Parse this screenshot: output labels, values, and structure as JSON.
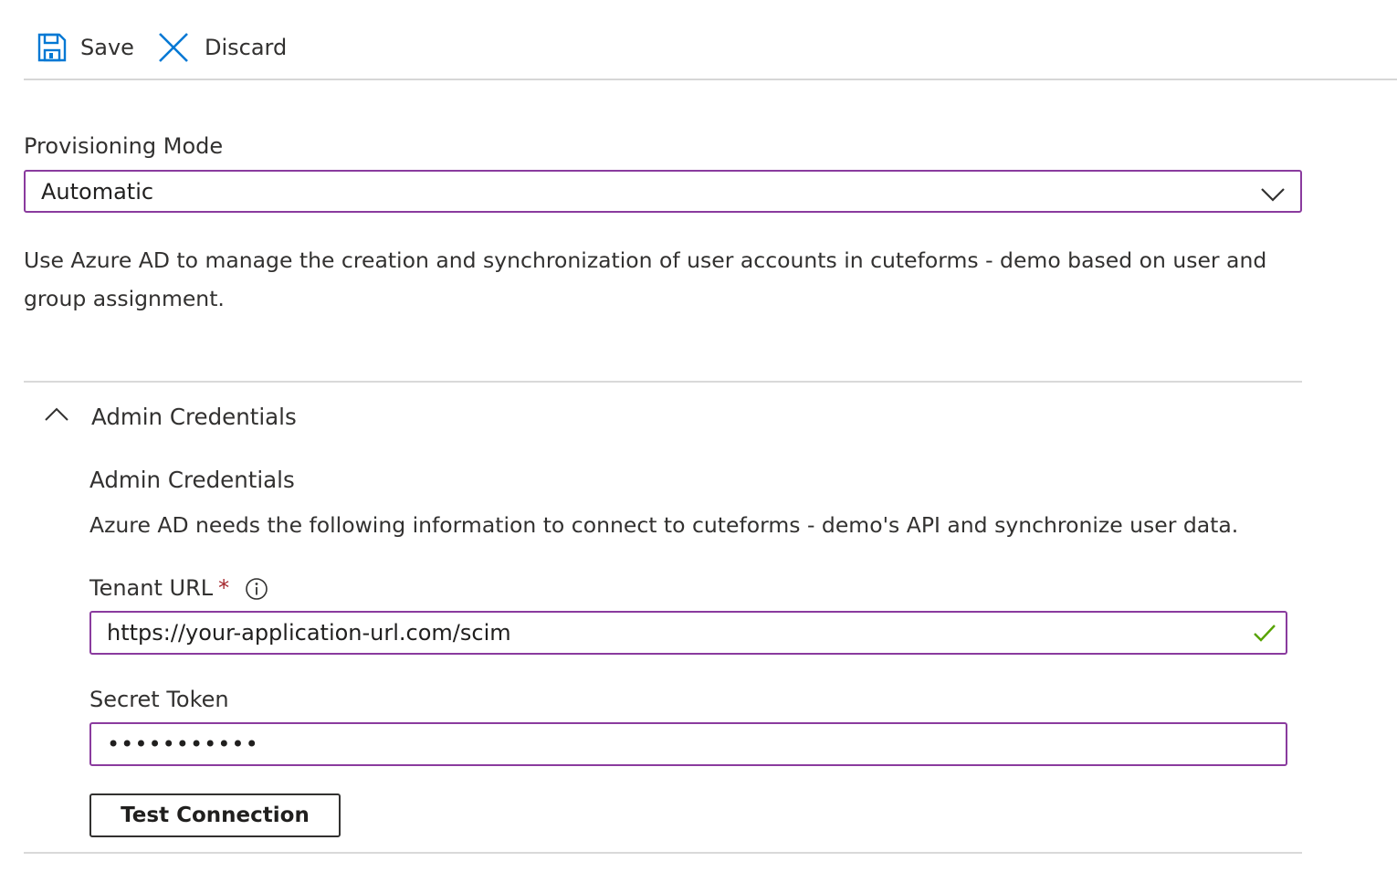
{
  "toolbar": {
    "save_label": "Save",
    "discard_label": "Discard",
    "save_icon": "floppy-disk-icon",
    "discard_icon": "close-x-icon",
    "accent_color": "#0078d4"
  },
  "provisioning": {
    "mode_label": "Provisioning Mode",
    "mode_value": "Automatic",
    "mode_icon": "chevron-down-icon",
    "description": "Use Azure AD to manage the creation and synchronization of user accounts in cuteforms - demo based on user and group assignment."
  },
  "admin_section": {
    "header_label": "Admin Credentials",
    "expanded": true,
    "header_icon": "chevron-up-icon",
    "title": "Admin Credentials",
    "description": "Azure AD needs the following information to connect to cuteforms - demo's API and synchronize user data.",
    "tenant_url": {
      "label": "Tenant URL",
      "required_marker": "*",
      "info_icon": "info-icon",
      "value": "https://your-application-url.com/scim",
      "valid": true,
      "valid_icon": "checkmark-icon"
    },
    "secret_token": {
      "label": "Secret Token",
      "value": "•••••••••••"
    },
    "test_button_label": "Test Connection"
  },
  "colors": {
    "focus_border": "#8a3b9e",
    "valid_check": "#57a300",
    "required_star": "#a4262c"
  }
}
